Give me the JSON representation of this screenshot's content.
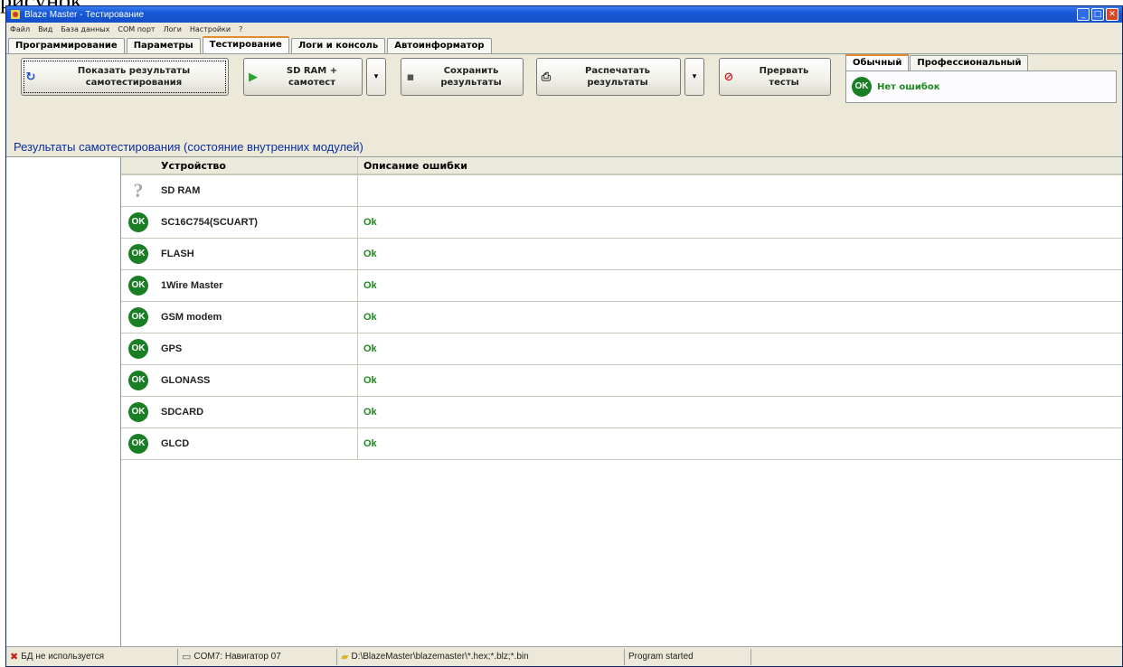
{
  "outer_caption": "рисунок",
  "window": {
    "title": "Blaze Master - Тестирование"
  },
  "menu": [
    "Файл",
    "Вид",
    "База данных",
    "COM порт",
    "Логи",
    "Настройки",
    "?"
  ],
  "tabs": [
    "Программирование",
    "Параметры",
    "Тестирование",
    "Логи и консоль",
    "Автоинформатор"
  ],
  "active_tab": "Тестирование",
  "toolbar": {
    "show_results": {
      "line1": "Показать результаты",
      "line2": "самотестирования"
    },
    "sdram_selftest": {
      "line1": "SD RAM +",
      "line2": "самотест"
    },
    "save_results": {
      "line1": "Сохранить",
      "line2": "результаты"
    },
    "print_results": {
      "line1": "Распечатать",
      "line2": "результаты"
    },
    "abort_tests": {
      "line1": "Прервать",
      "line2": "тесты"
    }
  },
  "mode": {
    "tabs": [
      "Обычный",
      "Профессиональный"
    ],
    "badge": "OK",
    "status": "Нет ошибок"
  },
  "section_title": "Результаты самотестирования (состояние внутренних модулей)",
  "grid": {
    "headers": {
      "device": "Устройство",
      "error": "Описание ошибки"
    },
    "rows": [
      {
        "status": "unknown",
        "badge": "?",
        "device": "SD RAM",
        "error": ""
      },
      {
        "status": "ok",
        "badge": "OK",
        "device": "SC16C754(SCUART)",
        "error": "Ok"
      },
      {
        "status": "ok",
        "badge": "OK",
        "device": "FLASH",
        "error": "Ok"
      },
      {
        "status": "ok",
        "badge": "OK",
        "device": "1Wire Master",
        "error": "Ok"
      },
      {
        "status": "ok",
        "badge": "OK",
        "device": "GSM modem",
        "error": "Ok"
      },
      {
        "status": "ok",
        "badge": "OK",
        "device": "GPS",
        "error": "Ok"
      },
      {
        "status": "ok",
        "badge": "OK",
        "device": "GLONASS",
        "error": "Ok"
      },
      {
        "status": "ok",
        "badge": "OK",
        "device": "SDCARD",
        "error": "Ok"
      },
      {
        "status": "ok",
        "badge": "OK",
        "device": "GLCD",
        "error": "Ok"
      }
    ]
  },
  "statusbar": {
    "db": "БД не используется",
    "com": "COM7: Навигатор 07",
    "path": "D:\\BlazeMaster\\blazemaster\\*.hex;*.blz;*.bin",
    "program": "Program started"
  },
  "colors": {
    "ok_green": "#1a7f24",
    "title_blue": "#0a2ea0",
    "tab_accent": "#e68b2c"
  }
}
